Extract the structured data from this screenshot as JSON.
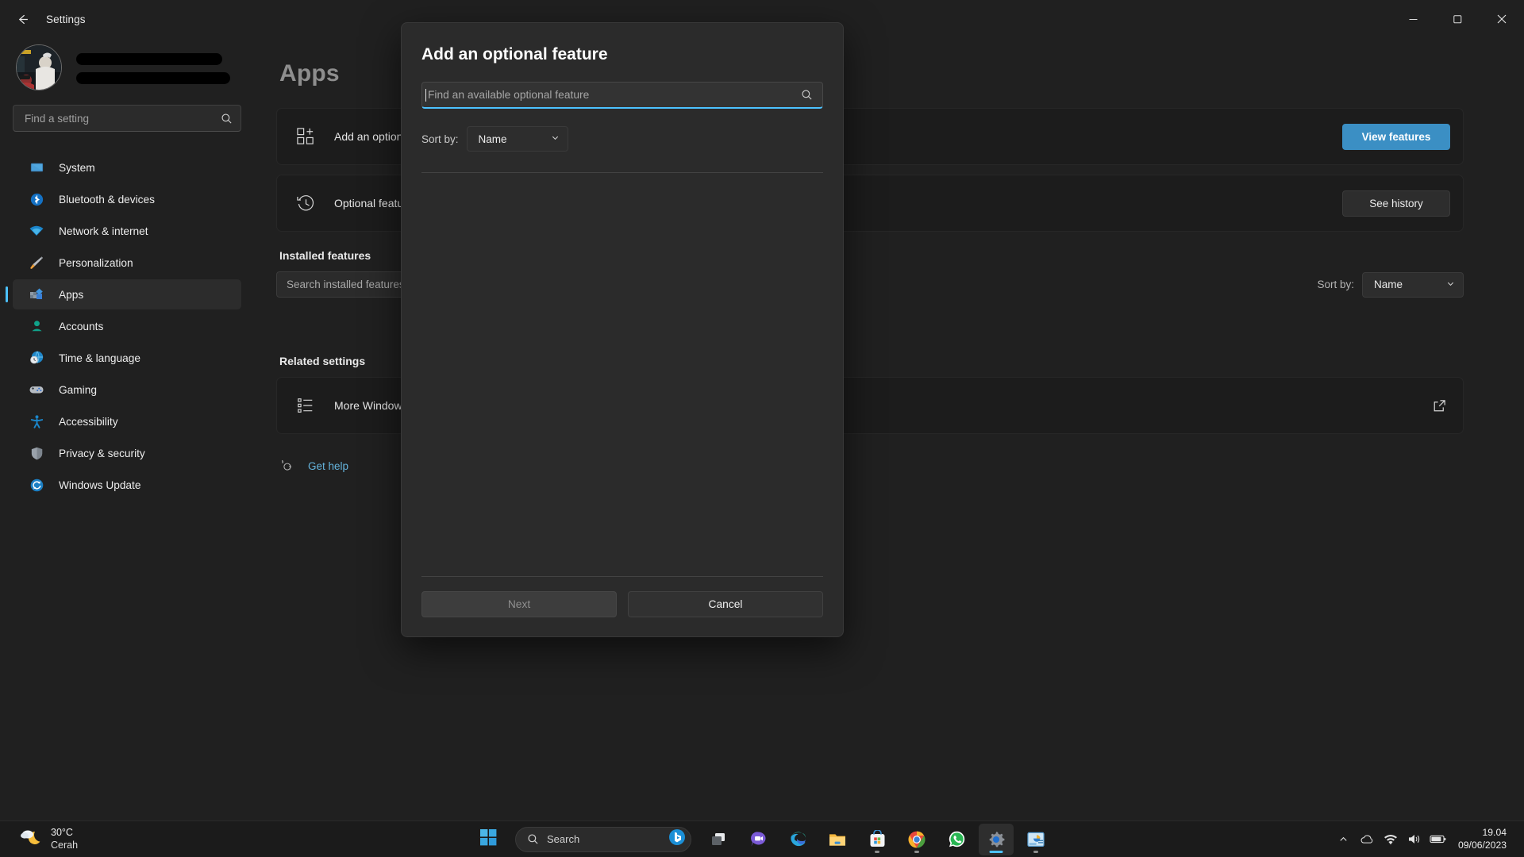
{
  "window": {
    "title": "Settings",
    "back_icon": "back-arrow-icon",
    "minimize_label": "─",
    "maximize_label": "❐",
    "close_label": "✕"
  },
  "sidebar": {
    "account": {
      "name_redacted": "",
      "email_redacted": ""
    },
    "search": {
      "placeholder": "Find a setting",
      "value": "",
      "icon": "search-icon"
    },
    "items": [
      {
        "label": "System",
        "icon": "monitor-icon",
        "selected": false
      },
      {
        "label": "Bluetooth & devices",
        "icon": "bluetooth-icon",
        "selected": false
      },
      {
        "label": "Network & internet",
        "icon": "wifi-icon",
        "selected": false
      },
      {
        "label": "Personalization",
        "icon": "paintbrush-icon",
        "selected": false
      },
      {
        "label": "Apps",
        "icon": "apps-icon",
        "selected": true
      },
      {
        "label": "Accounts",
        "icon": "person-icon",
        "selected": false
      },
      {
        "label": "Time & language",
        "icon": "clock-globe-icon",
        "selected": false
      },
      {
        "label": "Gaming",
        "icon": "gamepad-icon",
        "selected": false
      },
      {
        "label": "Accessibility",
        "icon": "accessibility-icon",
        "selected": false
      },
      {
        "label": "Privacy & security",
        "icon": "shield-icon",
        "selected": false
      },
      {
        "label": "Windows Update",
        "icon": "update-icon",
        "selected": false
      }
    ]
  },
  "content": {
    "page_title": "Apps",
    "cards": [
      {
        "label": "Add an optional feature",
        "icon": "add-feature-icon",
        "button": "View features",
        "accent": true
      },
      {
        "label": "Optional feature history",
        "icon": "history-icon",
        "button": "See history",
        "accent": false
      }
    ],
    "installed": {
      "heading": "Installed features",
      "search_placeholder": "Search installed features",
      "sort_label": "Sort by:",
      "sort_value": "Name"
    },
    "related": {
      "heading": "Related settings",
      "item_label": "More Windows features",
      "item_icon": "list-icon",
      "open_icon": "external-link-icon"
    },
    "help": {
      "icon": "help-icon",
      "label": "Get help"
    }
  },
  "dialog": {
    "title": "Add an optional feature",
    "search": {
      "placeholder": "Find an available optional feature",
      "value": "",
      "icon": "search-icon"
    },
    "sort_label": "Sort by:",
    "sort_value": "Name",
    "next_label": "Next",
    "cancel_label": "Cancel"
  },
  "taskbar": {
    "weather": {
      "temp": "30°C",
      "condition": "Cerah",
      "icon": "moon-cloud-icon"
    },
    "start_icon": "windows-start-icon",
    "search": {
      "label": "Search",
      "icon": "search-icon",
      "assistant_icon": "bing-chat-icon"
    },
    "apps": [
      {
        "name": "task-view-icon",
        "active": false,
        "running": false
      },
      {
        "name": "chat-icon",
        "active": false,
        "running": false
      },
      {
        "name": "edge-icon",
        "active": false,
        "running": false
      },
      {
        "name": "file-explorer-icon",
        "active": false,
        "running": false
      },
      {
        "name": "microsoft-store-icon",
        "active": false,
        "running": true
      },
      {
        "name": "chrome-icon",
        "active": false,
        "running": true
      },
      {
        "name": "whatsapp-icon",
        "active": false,
        "running": false
      },
      {
        "name": "settings-icon",
        "active": true,
        "running": true
      },
      {
        "name": "control-panel-icon",
        "active": false,
        "running": true
      }
    ],
    "tray": [
      {
        "name": "show-hidden-icons-chevron"
      },
      {
        "name": "onedrive-cloud-icon"
      },
      {
        "name": "wifi-icon"
      },
      {
        "name": "volume-icon"
      },
      {
        "name": "battery-icon"
      }
    ],
    "clock": {
      "time": "19.04",
      "date": "09/06/2023"
    }
  },
  "colors": {
    "accent": "#3b8fc4",
    "focus": "#4cc2ff",
    "link": "#64b3dc"
  }
}
